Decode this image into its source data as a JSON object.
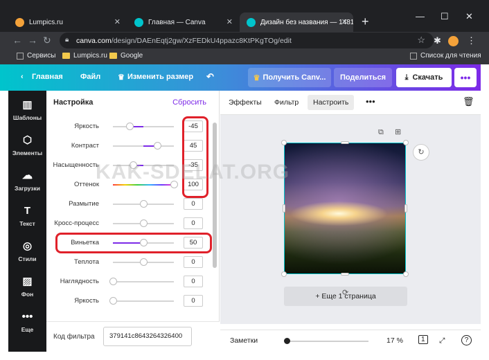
{
  "browser": {
    "tabs": [
      {
        "title": "Lumpics.ru",
        "favicon_color": "#f4a23a"
      },
      {
        "title": "Главная — Canva",
        "favicon_color": "#00c4cc"
      },
      {
        "title": "Дизайн без названия — 1481",
        "favicon_color": "#00c4cc"
      }
    ],
    "url_domain": "canva.com",
    "url_path": "/design/DAEnEqtj2gw/XzFEDkU4ppazc8KtPKgTOg/edit",
    "bookmarks": [
      "Сервисы",
      "Lumpics.ru",
      "Google"
    ],
    "reading_list": "Список для чтения"
  },
  "canva_header": {
    "home": "Главная",
    "file": "Файл",
    "resize": "Изменить размер",
    "upgrade": "Получить Canv...",
    "share": "Поделиться",
    "download": "Скачать"
  },
  "sidebar": {
    "items": [
      {
        "label": "Шаблоны",
        "icon": "templates-icon"
      },
      {
        "label": "Элементы",
        "icon": "elements-icon"
      },
      {
        "label": "Загрузки",
        "icon": "upload-icon"
      },
      {
        "label": "Текст",
        "icon": "text-icon"
      },
      {
        "label": "Стили",
        "icon": "palette-icon"
      },
      {
        "label": "Фон",
        "icon": "background-icon"
      },
      {
        "label": "Еще",
        "icon": "more-icon"
      }
    ]
  },
  "adjust_panel": {
    "title": "Настройка",
    "reset": "Сбросить",
    "rows": [
      {
        "label": "Яркость",
        "value": "-45",
        "fraction": 0.275
      },
      {
        "label": "Контраст",
        "value": "45",
        "fraction": 0.725
      },
      {
        "label": "Насыщенность",
        "value": "-35",
        "fraction": 0.325
      },
      {
        "label": "Оттенок",
        "value": "100",
        "fraction": 1.0
      },
      {
        "label": "Размытие",
        "value": "0",
        "fraction": 0.5
      },
      {
        "label": "Кросс-процесс",
        "value": "0",
        "fraction": 0.5
      },
      {
        "label": "Виньетка",
        "value": "50",
        "fraction": 0.5
      },
      {
        "label": "Теплота",
        "value": "0",
        "fraction": 0.5
      },
      {
        "label": "Наглядность",
        "value": "0",
        "fraction": 0.0
      },
      {
        "label": "Яркость",
        "value": "0",
        "fraction": 0.0
      }
    ],
    "filter_code_label": "Код фильтра",
    "filter_code_value": "379141c8643264326400"
  },
  "edit_toolbar": {
    "effects": "Эффекты",
    "filter": "Фильтр",
    "adjust": "Настроить"
  },
  "canvas": {
    "add_page": "+ Еще 1 страница",
    "watermark": "KAK-SDELAT.ORG"
  },
  "footer": {
    "notes": "Заметки",
    "zoom": "17 %",
    "page_count": "1"
  },
  "colors": {
    "accent": "#7d2ae8",
    "highlight": "#e0212a"
  }
}
